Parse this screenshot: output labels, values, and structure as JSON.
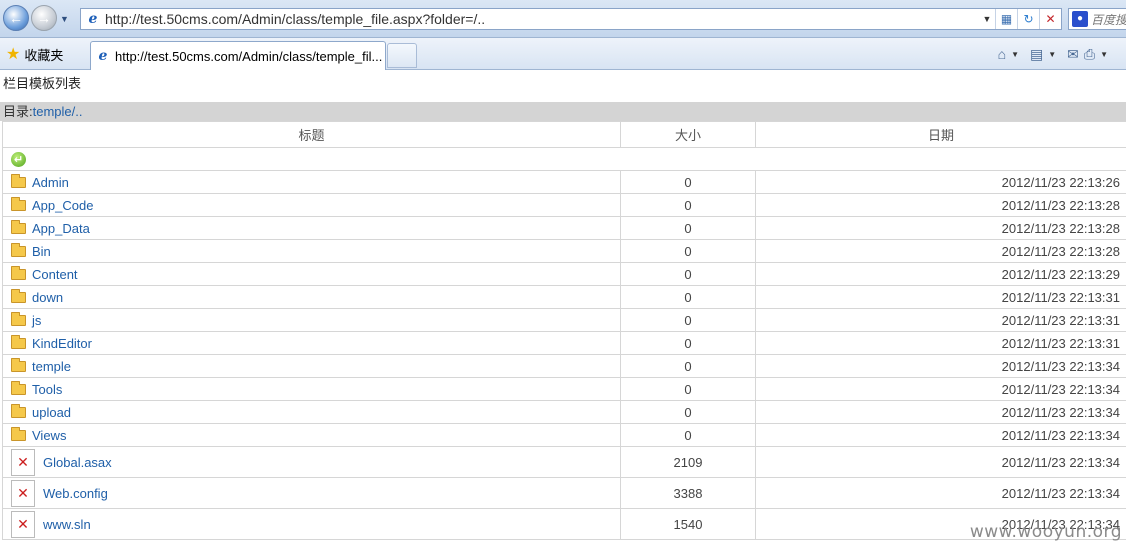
{
  "browser": {
    "address": "http://test.50cms.com/Admin/class/temple_file.aspx?folder=/..",
    "search_placeholder": "百度搜",
    "favorites_label": "收藏夹",
    "tab_title": "http://test.50cms.com/Admin/class/temple_fil..."
  },
  "page": {
    "title": "栏目模板列表",
    "dir_label": "目录:",
    "dir_path": "temple/..",
    "columns": {
      "name": "标题",
      "size": "大小",
      "date": "日期"
    }
  },
  "rows": [
    {
      "type": "folder",
      "name": "Admin",
      "size": "0",
      "date": "2012/11/23 22:13:26"
    },
    {
      "type": "folder",
      "name": "App_Code",
      "size": "0",
      "date": "2012/11/23 22:13:28"
    },
    {
      "type": "folder",
      "name": "App_Data",
      "size": "0",
      "date": "2012/11/23 22:13:28"
    },
    {
      "type": "folder",
      "name": "Bin",
      "size": "0",
      "date": "2012/11/23 22:13:28"
    },
    {
      "type": "folder",
      "name": "Content",
      "size": "0",
      "date": "2012/11/23 22:13:29"
    },
    {
      "type": "folder",
      "name": "down",
      "size": "0",
      "date": "2012/11/23 22:13:31"
    },
    {
      "type": "folder",
      "name": "js",
      "size": "0",
      "date": "2012/11/23 22:13:31"
    },
    {
      "type": "folder",
      "name": "KindEditor",
      "size": "0",
      "date": "2012/11/23 22:13:31"
    },
    {
      "type": "folder",
      "name": "temple",
      "size": "0",
      "date": "2012/11/23 22:13:34"
    },
    {
      "type": "folder",
      "name": "Tools",
      "size": "0",
      "date": "2012/11/23 22:13:34"
    },
    {
      "type": "folder",
      "name": "upload",
      "size": "0",
      "date": "2012/11/23 22:13:34"
    },
    {
      "type": "folder",
      "name": "Views",
      "size": "0",
      "date": "2012/11/23 22:13:34"
    },
    {
      "type": "file",
      "name": "Global.asax",
      "size": "2109",
      "date": "2012/11/23 22:13:34"
    },
    {
      "type": "file",
      "name": "Web.config",
      "size": "3388",
      "date": "2012/11/23 22:13:34"
    },
    {
      "type": "file",
      "name": "www.sln",
      "size": "1540",
      "date": "2012/11/23 22:13:34"
    }
  ],
  "icons": {
    "back": "back-arrow-icon",
    "forward": "forward-arrow-icon",
    "up": "up-directory-icon",
    "folder": "folder-icon",
    "file": "broken-image-icon"
  },
  "watermark": "www.wooyun.org"
}
